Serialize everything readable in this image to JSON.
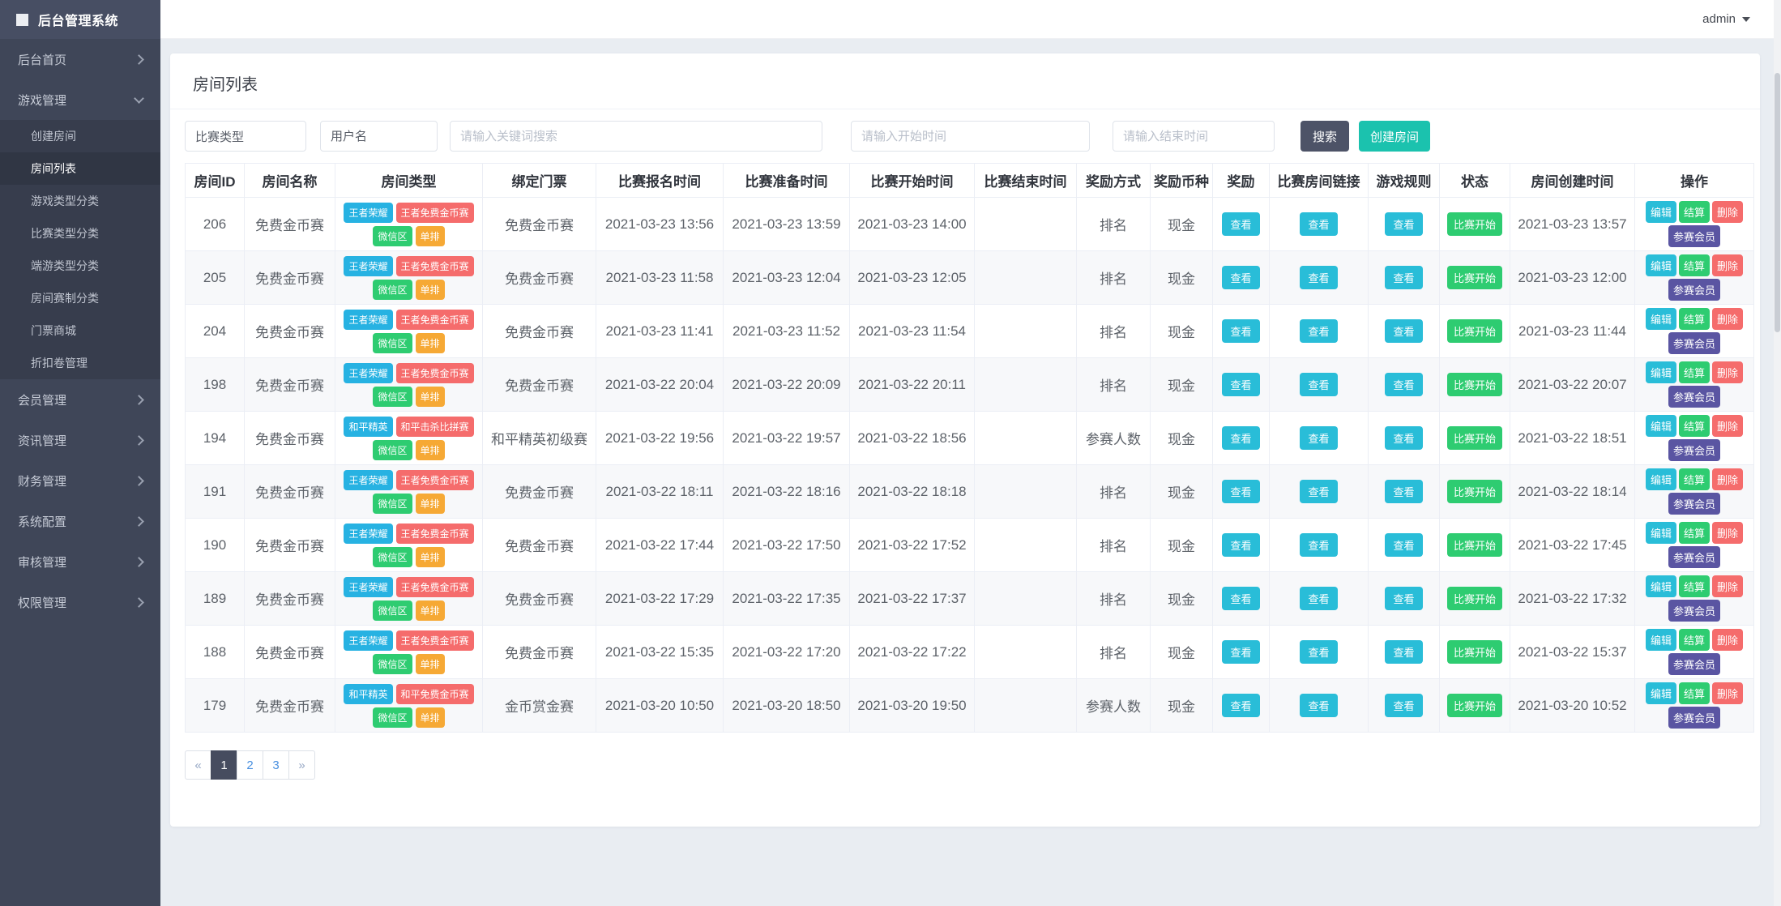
{
  "app": {
    "title": "后台管理系统",
    "user": "admin"
  },
  "page": {
    "title": "房间列表"
  },
  "filters": {
    "match_type": "比赛类型",
    "username_placeholder": "用户名",
    "keyword_placeholder": "请输入关键词搜索",
    "start_placeholder": "请输入开始时间",
    "end_placeholder": "请输入结束时间",
    "search_label": "搜索",
    "create_label": "创建房间"
  },
  "sidebar": {
    "items": [
      {
        "name": "home",
        "label": "后台首页",
        "chevron": "right"
      },
      {
        "name": "game-management",
        "label": "游戏管理",
        "chevron": "down",
        "expanded": true,
        "children": [
          {
            "name": "create-room",
            "label": "创建房间"
          },
          {
            "name": "room-list",
            "label": "房间列表",
            "active": true
          },
          {
            "name": "game-type-category",
            "label": "游戏类型分类"
          },
          {
            "name": "match-type-category",
            "label": "比赛类型分类"
          },
          {
            "name": "pc-game-type-category",
            "label": "端游类型分类"
          },
          {
            "name": "room-format-category",
            "label": "房间赛制分类"
          },
          {
            "name": "ticket-mall",
            "label": "门票商城"
          },
          {
            "name": "coupon-management",
            "label": "折扣卷管理"
          }
        ]
      },
      {
        "name": "member-management",
        "label": "会员管理",
        "chevron": "right"
      },
      {
        "name": "news-management",
        "label": "资讯管理",
        "chevron": "right"
      },
      {
        "name": "finance-management",
        "label": "财务管理",
        "chevron": "right"
      },
      {
        "name": "system-config",
        "label": "系统配置",
        "chevron": "right"
      },
      {
        "name": "audit-management",
        "label": "审核管理",
        "chevron": "right"
      },
      {
        "name": "permission-management",
        "label": "权限管理",
        "chevron": "right"
      }
    ]
  },
  "table": {
    "columns": [
      "房间ID",
      "房间名称",
      "房间类型",
      "绑定门票",
      "比赛报名时间",
      "比赛准备时间",
      "比赛开始时间",
      "比赛结束时间",
      "奖励方式",
      "奖励币种",
      "奖励",
      "比赛房间链接",
      "游戏规则",
      "状态",
      "房间创建时间",
      "操作"
    ],
    "labels": {
      "view": "查看",
      "status": "比赛开始",
      "edit": "编辑",
      "settle": "结算",
      "delete": "删除",
      "members": "参赛会员"
    },
    "rows": [
      {
        "id": "206",
        "name": "免费金币赛",
        "tags": [
          [
            "王者荣耀",
            "blue"
          ],
          [
            "王者免费金币赛",
            "red"
          ],
          [
            "微信区",
            "green"
          ],
          [
            "单排",
            "orange"
          ]
        ],
        "ticket": "免费金币赛",
        "signup": "2021-03-23 13:56",
        "ready": "2021-03-23 13:59",
        "start": "2021-03-23 14:00",
        "end": "",
        "reward_mode": "排名",
        "currency": "现金",
        "created": "2021-03-23 13:57"
      },
      {
        "id": "205",
        "name": "免费金币赛",
        "tags": [
          [
            "王者荣耀",
            "blue"
          ],
          [
            "王者免费金币赛",
            "red"
          ],
          [
            "微信区",
            "green"
          ],
          [
            "单排",
            "orange"
          ]
        ],
        "ticket": "免费金币赛",
        "signup": "2021-03-23 11:58",
        "ready": "2021-03-23 12:04",
        "start": "2021-03-23 12:05",
        "end": "",
        "reward_mode": "排名",
        "currency": "现金",
        "created": "2021-03-23 12:00"
      },
      {
        "id": "204",
        "name": "免费金币赛",
        "tags": [
          [
            "王者荣耀",
            "blue"
          ],
          [
            "王者免费金币赛",
            "red"
          ],
          [
            "微信区",
            "green"
          ],
          [
            "单排",
            "orange"
          ]
        ],
        "ticket": "免费金币赛",
        "signup": "2021-03-23 11:41",
        "ready": "2021-03-23 11:52",
        "start": "2021-03-23 11:54",
        "end": "",
        "reward_mode": "排名",
        "currency": "现金",
        "created": "2021-03-23 11:44"
      },
      {
        "id": "198",
        "name": "免费金币赛",
        "tags": [
          [
            "王者荣耀",
            "blue"
          ],
          [
            "王者免费金币赛",
            "red"
          ],
          [
            "微信区",
            "green"
          ],
          [
            "单排",
            "orange"
          ]
        ],
        "ticket": "免费金币赛",
        "signup": "2021-03-22 20:04",
        "ready": "2021-03-22 20:09",
        "start": "2021-03-22 20:11",
        "end": "",
        "reward_mode": "排名",
        "currency": "现金",
        "created": "2021-03-22 20:07"
      },
      {
        "id": "194",
        "name": "免费金币赛",
        "tags": [
          [
            "和平精英",
            "blue"
          ],
          [
            "和平击杀比拼赛",
            "red"
          ],
          [
            "微信区",
            "green"
          ],
          [
            "单排",
            "orange"
          ]
        ],
        "ticket": "和平精英初级赛",
        "signup": "2021-03-22 19:56",
        "ready": "2021-03-22 19:57",
        "start": "2021-03-22 18:56",
        "end": "",
        "reward_mode": "参赛人数",
        "currency": "现金",
        "created": "2021-03-22 18:51"
      },
      {
        "id": "191",
        "name": "免费金币赛",
        "tags": [
          [
            "王者荣耀",
            "blue"
          ],
          [
            "王者免费金币赛",
            "red"
          ],
          [
            "微信区",
            "green"
          ],
          [
            "单排",
            "orange"
          ]
        ],
        "ticket": "免费金币赛",
        "signup": "2021-03-22 18:11",
        "ready": "2021-03-22 18:16",
        "start": "2021-03-22 18:18",
        "end": "",
        "reward_mode": "排名",
        "currency": "现金",
        "created": "2021-03-22 18:14"
      },
      {
        "id": "190",
        "name": "免费金币赛",
        "tags": [
          [
            "王者荣耀",
            "blue"
          ],
          [
            "王者免费金币赛",
            "red"
          ],
          [
            "微信区",
            "green"
          ],
          [
            "单排",
            "orange"
          ]
        ],
        "ticket": "免费金币赛",
        "signup": "2021-03-22 17:44",
        "ready": "2021-03-22 17:50",
        "start": "2021-03-22 17:52",
        "end": "",
        "reward_mode": "排名",
        "currency": "现金",
        "created": "2021-03-22 17:45"
      },
      {
        "id": "189",
        "name": "免费金币赛",
        "tags": [
          [
            "王者荣耀",
            "blue"
          ],
          [
            "王者免费金币赛",
            "red"
          ],
          [
            "微信区",
            "green"
          ],
          [
            "单排",
            "orange"
          ]
        ],
        "ticket": "免费金币赛",
        "signup": "2021-03-22 17:29",
        "ready": "2021-03-22 17:35",
        "start": "2021-03-22 17:37",
        "end": "",
        "reward_mode": "排名",
        "currency": "现金",
        "created": "2021-03-22 17:32"
      },
      {
        "id": "188",
        "name": "免费金币赛",
        "tags": [
          [
            "王者荣耀",
            "blue"
          ],
          [
            "王者免费金币赛",
            "red"
          ],
          [
            "微信区",
            "green"
          ],
          [
            "单排",
            "orange"
          ]
        ],
        "ticket": "免费金币赛",
        "signup": "2021-03-22 15:35",
        "ready": "2021-03-22 17:20",
        "start": "2021-03-22 17:22",
        "end": "",
        "reward_mode": "排名",
        "currency": "现金",
        "created": "2021-03-22 15:37"
      },
      {
        "id": "179",
        "name": "免费金币赛",
        "tags": [
          [
            "和平精英",
            "blue"
          ],
          [
            "和平免费金币赛",
            "red"
          ],
          [
            "微信区",
            "green"
          ],
          [
            "单排",
            "orange"
          ]
        ],
        "ticket": "金币赏金赛",
        "signup": "2021-03-20 10:50",
        "ready": "2021-03-20 18:50",
        "start": "2021-03-20 19:50",
        "end": "",
        "reward_mode": "参赛人数",
        "currency": "现金",
        "created": "2021-03-20 10:52"
      }
    ]
  },
  "pagination": {
    "prev": "«",
    "pages": [
      "1",
      "2",
      "3"
    ],
    "next": "»",
    "active": "1"
  },
  "colors": {
    "sidebar_bg": "#3f4658",
    "accent_teal": "#1bc2ae",
    "search_dark": "#4d5367",
    "tag_blue": "#27b2e2",
    "tag_red": "#f56c6c",
    "tag_green": "#2ecc71",
    "tag_orange": "#f6a935",
    "view_cyan": "#29bdd8",
    "members_purple": "#5a55a2",
    "pager_active": "#464c5f"
  }
}
